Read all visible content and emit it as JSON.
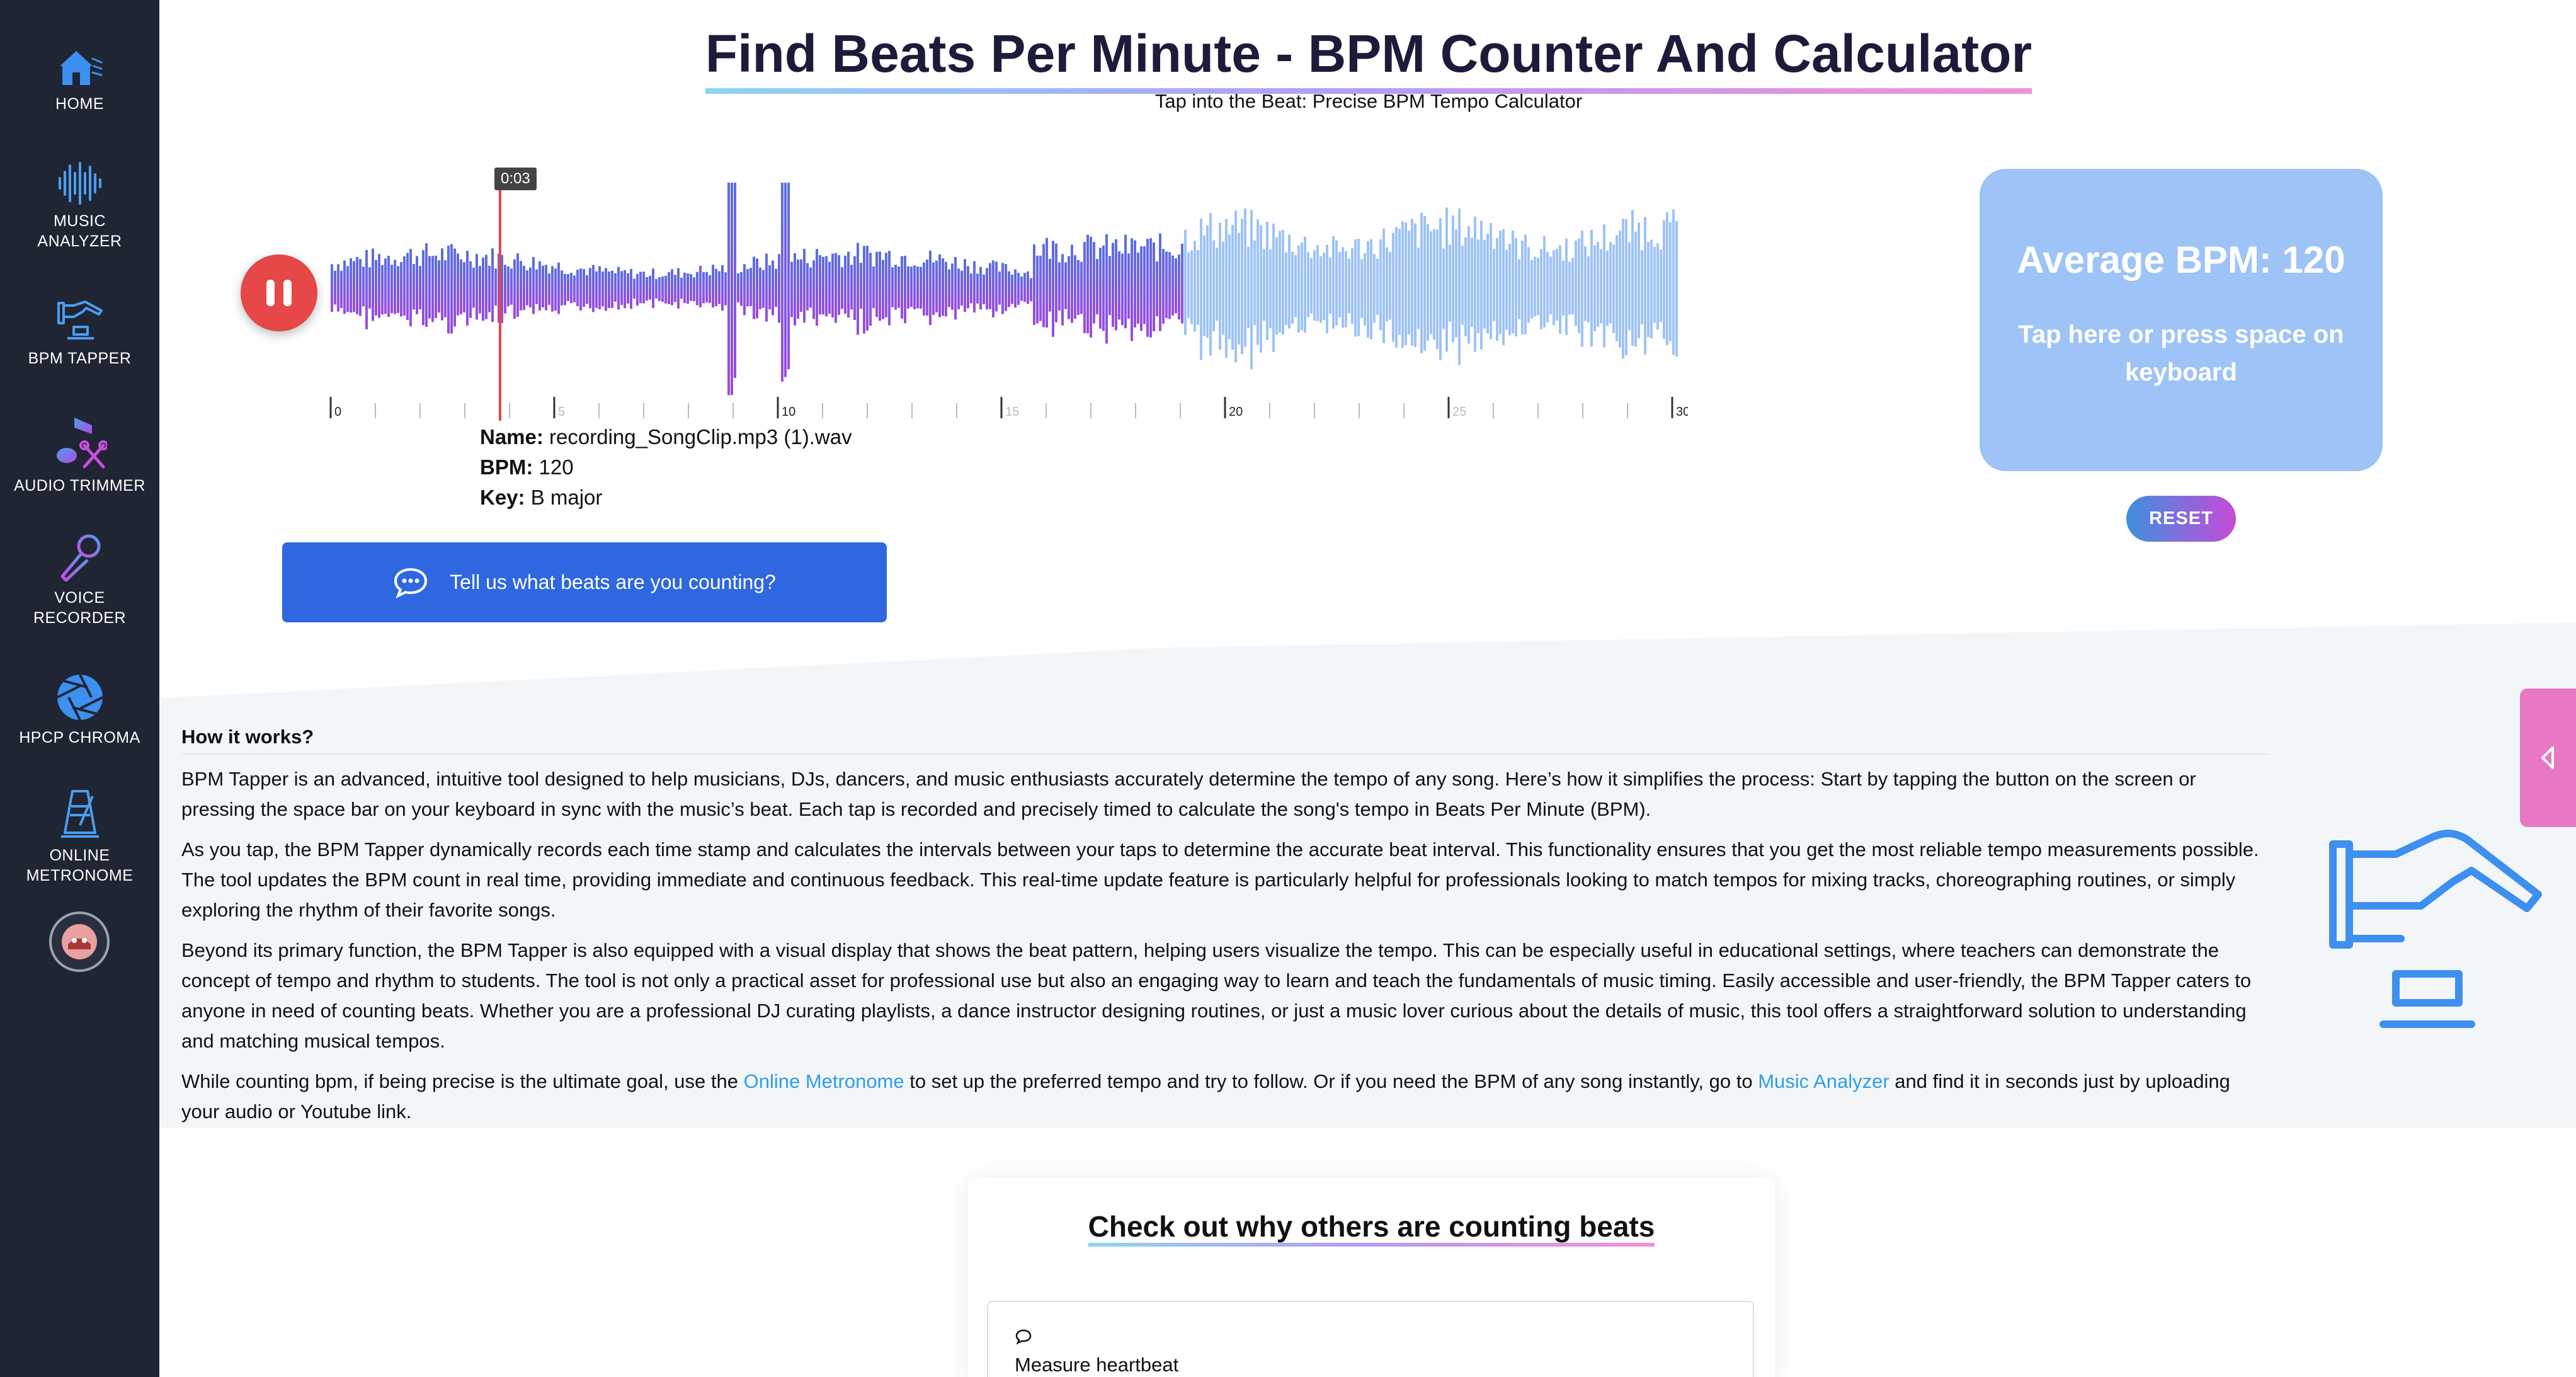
{
  "sidebar": {
    "items": [
      {
        "label": "HOME",
        "icon": "home-icon"
      },
      {
        "label": "MUSIC ANALYZER",
        "icon": "soundwave-icon"
      },
      {
        "label": "BPM TAPPER",
        "icon": "tap-hand-icon"
      },
      {
        "label": "AUDIO TRIMMER",
        "icon": "music-note-icon"
      },
      {
        "label": "VOICE RECORDER",
        "icon": "microphone-icon"
      },
      {
        "label": "HPCP CHROMA",
        "icon": "chroma-wheel-icon"
      },
      {
        "label": "ONLINE METRONOME",
        "icon": "metronome-icon"
      }
    ],
    "avatar_icon": "user-avatar-icon"
  },
  "header": {
    "title": "Find Beats Per Minute - BPM Counter And Calculator",
    "subtitle": "Tap into the Beat: Precise BPM Tempo Calculator"
  },
  "player": {
    "state_icon": "pause-icon",
    "current_time": "0:03",
    "progress_fraction": 0.633,
    "timeline_labels": [
      "0",
      "5",
      "10",
      "15",
      "20",
      "25",
      "30"
    ],
    "played_color_start": "#5b6fe0",
    "played_color_end": "#9b4be0",
    "unplayed_color": "#9ec3f6",
    "playhead_color": "#e04848"
  },
  "track": {
    "name_label": "Name:",
    "name_value": "recording_SongClip.mp3 (1).wav",
    "bpm_label": "BPM:",
    "bpm_value": "120",
    "key_label": "Key:",
    "key_value": "B major"
  },
  "feedback": {
    "icon": "chat-bubble-icon",
    "label": "Tell us what beats are you counting?"
  },
  "tapper": {
    "average_label": "Average BPM: 120",
    "hint": "Tap here or press space on keyboard",
    "reset_label": "RESET",
    "card_color": "#9ec3f6"
  },
  "how_it_works": {
    "heading": "How it works?",
    "p1": "BPM Tapper is an advanced, intuitive tool designed to help musicians, DJs, dancers, and music enthusiasts accurately determine the tempo of any song. Here’s how it simplifies the process: Start by tapping the button on the screen or pressing the space bar on your keyboard in sync with the music’s beat. Each tap is recorded and precisely timed to calculate the song's tempo in Beats Per Minute (BPM).",
    "p2": "As you tap, the BPM Tapper dynamically records each time stamp and calculates the intervals between your taps to determine the accurate beat interval. This functionality ensures that you get the most reliable tempo measurements possible. The tool updates the BPM count in real time, providing immediate and continuous feedback. This real-time update feature is particularly helpful for professionals looking to match tempos for mixing tracks, choreographing routines, or simply exploring the rhythm of their favorite songs.",
    "p3": "Beyond its primary function, the BPM Tapper is also equipped with a visual display that shows the beat pattern, helping users visualize the tempo. This can be especially useful in educational settings, where teachers can demonstrate the concept of tempo and rhythm to students. The tool is not only a practical asset for professional use but also an engaging way to learn and teach the fundamentals of music timing. Easily accessible and user-friendly, the BPM Tapper caters to anyone in need of counting beats. Whether you are a professional DJ curating playlists, a dance instructor designing routines, or just a music lover curious about the details of music, this tool offers a straightforward solution to understanding and matching musical tempos.",
    "p4_before": "While counting bpm, if being precise is the ultimate goal, use the ",
    "p4_link1": "Online Metronome",
    "p4_middle": " to set up the preferred tempo and try to follow. Or if you need the BPM of any song instantly, go to ",
    "p4_link2": "Music Analyzer",
    "p4_after": " and find it in seconds just by uploading your audio or Youtube link."
  },
  "side_tab": {
    "icon": "chevron-left-icon"
  },
  "illustration": {
    "icon": "tap-hand-illustration"
  },
  "why": {
    "title": "Check out why others are counting beats",
    "reasons": [
      {
        "icon": "chat-bubble-icon",
        "label": "Measure heartbeat"
      }
    ]
  }
}
